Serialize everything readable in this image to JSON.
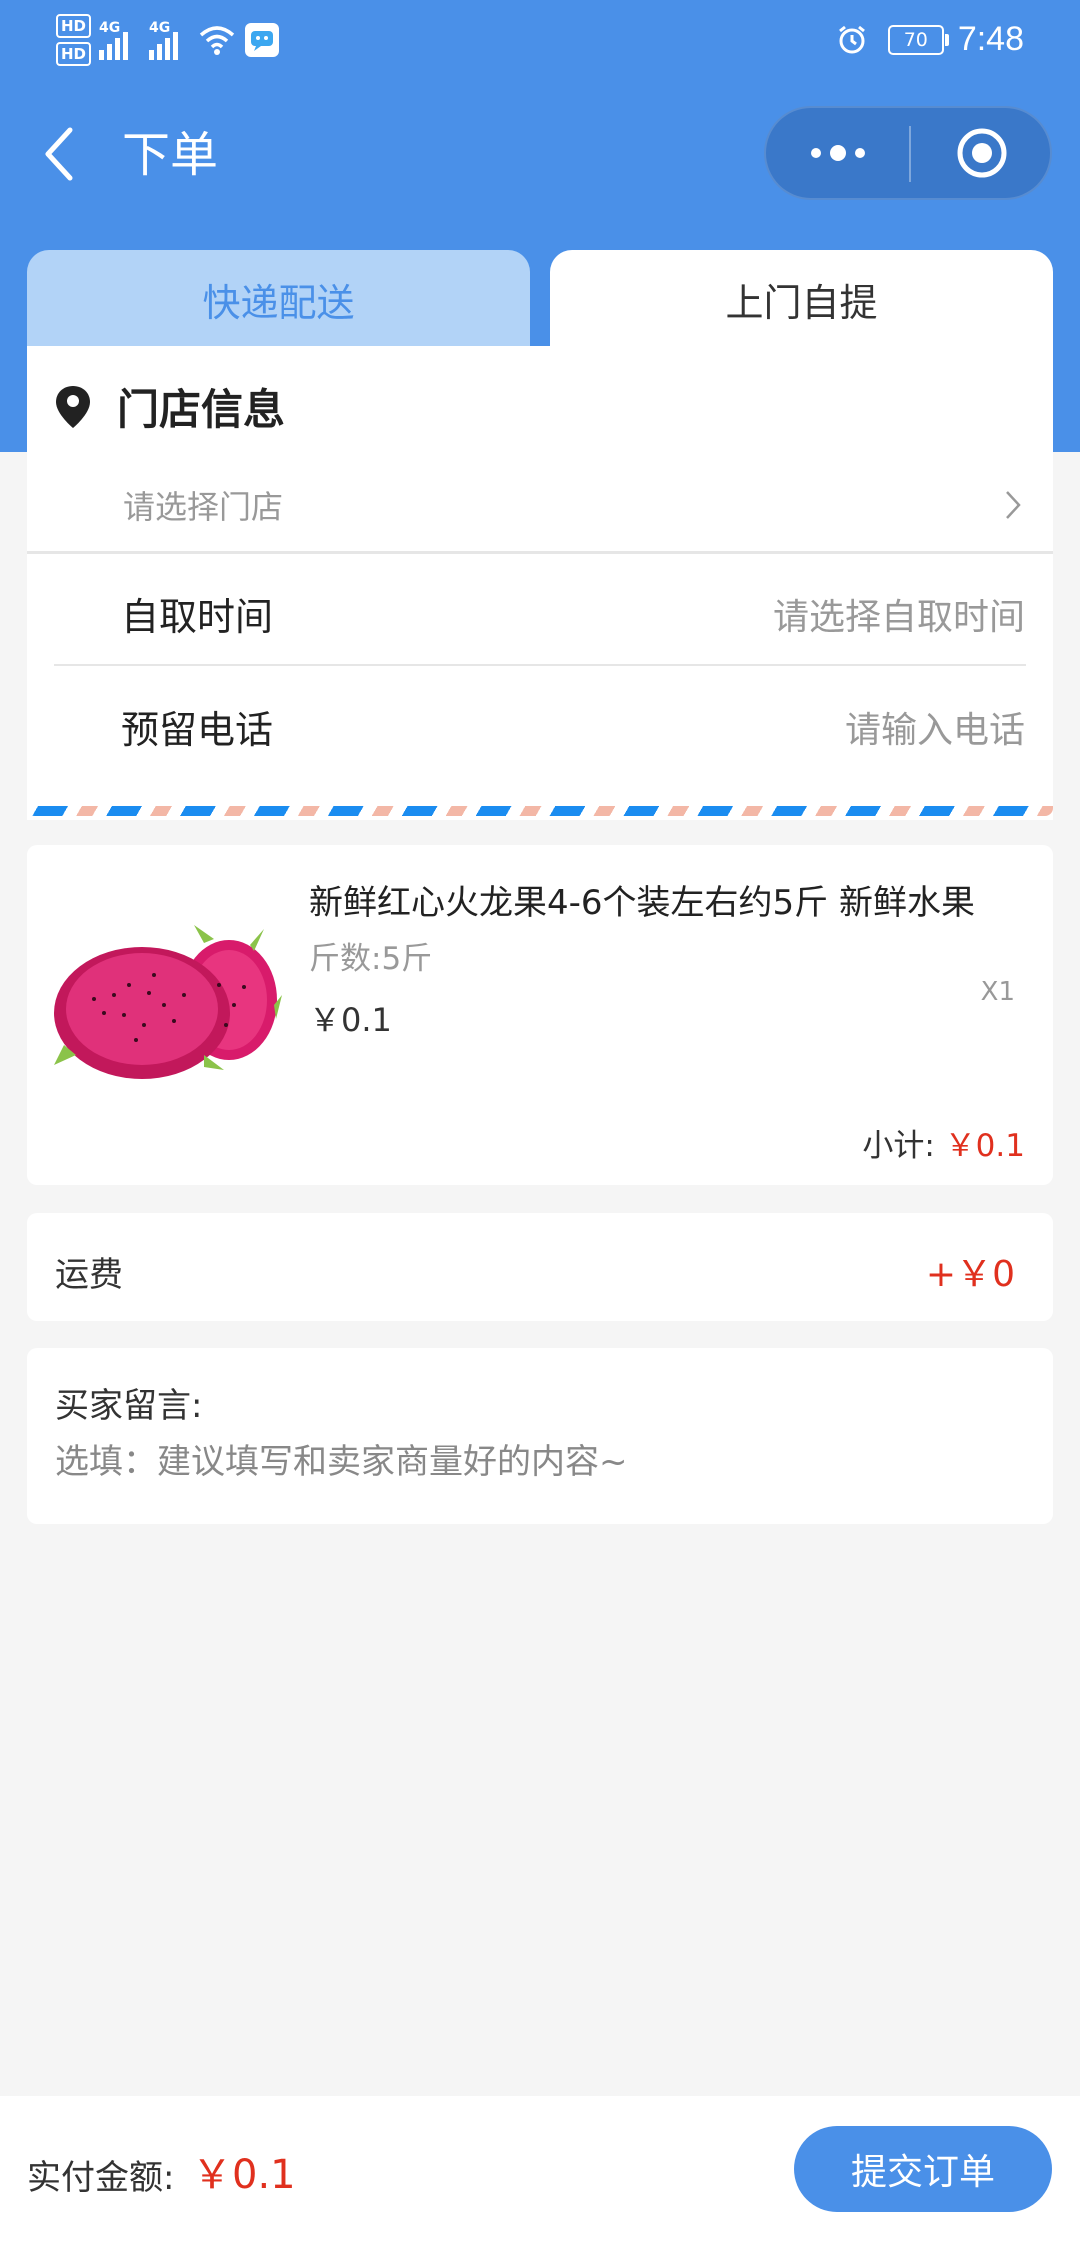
{
  "status_bar": {
    "hd1": "HD",
    "hd2": "HD",
    "net1": "4G",
    "net2": "4G",
    "battery": "70",
    "time": "7:48"
  },
  "nav": {
    "title": "下单"
  },
  "tabs": [
    {
      "label": "快递配送",
      "active": false
    },
    {
      "label": "上门自提",
      "active": true
    }
  ],
  "store": {
    "title": "门店信息",
    "select_placeholder": "请选择门店"
  },
  "pickup_time": {
    "label": "自取时间",
    "placeholder": "请选择自取时间"
  },
  "phone": {
    "label": "预留电话",
    "placeholder": "请输入电话"
  },
  "product": {
    "name": "新鲜红心火龙果4-6个装左右约5斤 新鲜水果",
    "spec": "斤数:5斤",
    "price": "￥0.1",
    "qty": "X1",
    "subtotal_label": "小计:",
    "subtotal_value": "￥0.1"
  },
  "freight": {
    "label": "运费",
    "value": "+￥0"
  },
  "message": {
    "label": "买家留言:",
    "placeholder": "选填：建议填写和卖家商量好的内容~"
  },
  "footer": {
    "total_label": "实付金额:",
    "total_value": "￥0.1",
    "submit_label": "提交订单"
  },
  "colors": {
    "primary": "#4a90e8",
    "price_red": "#e0301e",
    "tab_inactive_bg": "#b2d3f7"
  }
}
